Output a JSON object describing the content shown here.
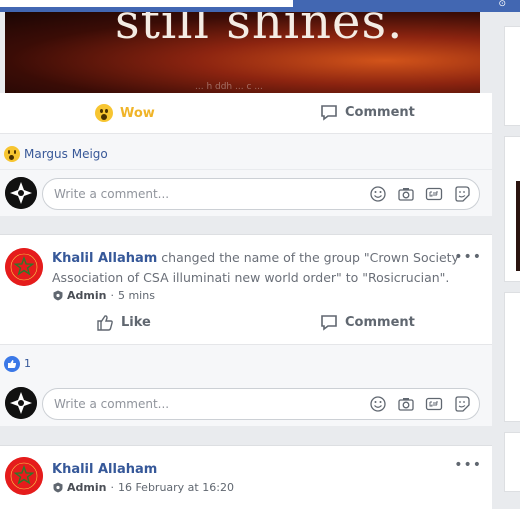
{
  "topbar": {
    "corner_glyph": "⊙"
  },
  "post1": {
    "image_text": "still shines.",
    "image_watermark": "... h ddh ... c ...",
    "wow_label": "Wow",
    "comment_label": "Comment",
    "reactor_name": "Margus Meigo",
    "comment_placeholder": "Write a comment..."
  },
  "post2": {
    "author": "Khalil Allaham",
    "action_text": " changed the name of the group \"Crown Society Association of CSA illuminati new world order\" to \"Rosicrucian\".",
    "role": "Admin",
    "separator": "·",
    "time": "5 mins",
    "like_label": "Like",
    "comment_label": "Comment",
    "like_count": "1",
    "comment_placeholder": "Write a comment..."
  },
  "post3": {
    "author": "Khalil Allaham",
    "role": "Admin",
    "separator": "·",
    "time": "16 February at 16:20"
  },
  "more_glyph": "•••",
  "colors": {
    "accent": "#4267b2",
    "link": "#365899",
    "wow": "#f0b428"
  }
}
